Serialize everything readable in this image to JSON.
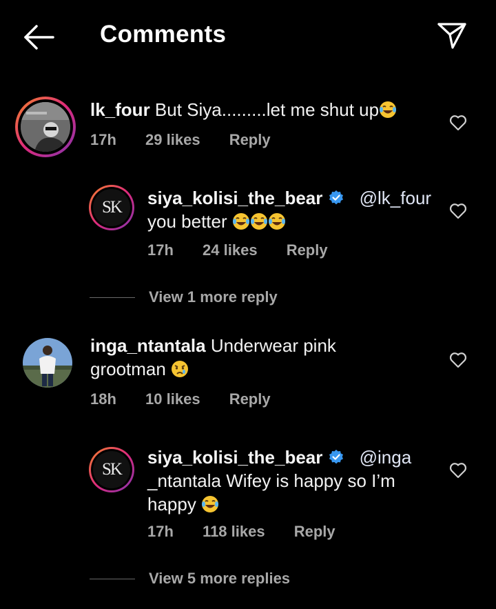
{
  "header": {
    "title": "Comments",
    "back_icon": "arrow-left-icon",
    "share_icon": "paper-plane-icon"
  },
  "comments": [
    {
      "username": "lk_four",
      "text": "But Siya.........let me shut up",
      "time": "17h",
      "likes": "29 likes",
      "reply": "Reply"
    },
    {
      "username": "siya_kolisi_the_bear",
      "mention": "@lk_four",
      "text_line2": "you better",
      "time": "17h",
      "likes": "24 likes",
      "reply": "Reply",
      "avatar_text": "SK"
    },
    {
      "view_more": "View 1 more reply"
    },
    {
      "username": "inga_ntantala",
      "text": "Underwear pink",
      "text_line2": "grootman",
      "time": "18h",
      "likes": "10 likes",
      "reply": "Reply"
    },
    {
      "username": "siya_kolisi_the_bear",
      "mention": "@inga",
      "text_line2": "_ntantala Wifey is happy so I’m",
      "text_line3": "happy",
      "time": "17h",
      "likes": "118 likes",
      "reply": "Reply",
      "avatar_text": "SK"
    },
    {
      "view_more": "View 5 more replies"
    }
  ],
  "colors": {
    "background": "#000000",
    "text": "#f2f2f2",
    "meta": "#a8a8a8",
    "verified": "#3897f0"
  }
}
